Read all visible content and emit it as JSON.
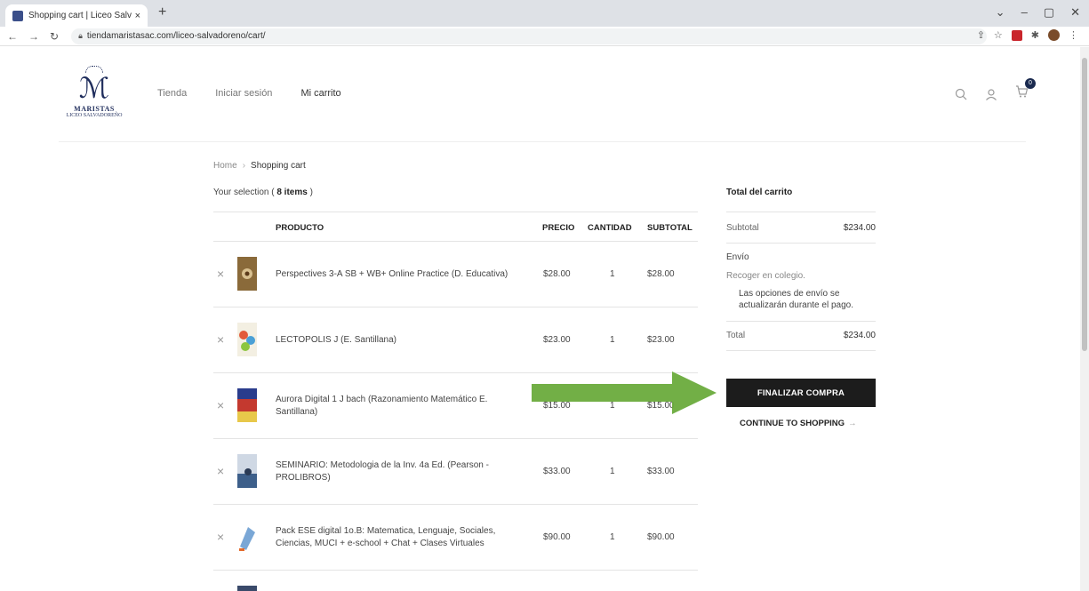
{
  "browser": {
    "tab_title": "Shopping cart | Liceo Salvadoreñ",
    "tab_close": "×",
    "new_tab": "+",
    "url": "tiendamaristasac.com/liceo-salvadoreno/cart/",
    "window_controls": [
      "⌄",
      "–",
      "▢",
      "✕"
    ]
  },
  "site": {
    "logo_line1": "MARISTAS",
    "logo_line2": "LICEO SALVADOREÑO",
    "nav": [
      {
        "label": "Tienda"
      },
      {
        "label": "Iniciar sesión"
      },
      {
        "label": "Mi carrito"
      }
    ],
    "cart_count": "0"
  },
  "breadcrumb": {
    "home": "Home",
    "separator": "›",
    "current": "Shopping cart"
  },
  "selection": {
    "prefix": "Your selection (",
    "count": "8 items",
    "suffix": ")"
  },
  "table": {
    "headers": {
      "product": "PRODUCTO",
      "price": "PRECIO",
      "qty": "CANTIDAD",
      "subtotal": "SUBTOTAL"
    },
    "rows": [
      {
        "name": "Perspectives 3-A SB + WB+ Online Practice (D. Educativa)",
        "price": "$28.00",
        "qty": "1",
        "subtotal": "$28.00"
      },
      {
        "name": "LECTOPOLIS J (E. Santillana)",
        "price": "$23.00",
        "qty": "1",
        "subtotal": "$23.00"
      },
      {
        "name": "Aurora Digital 1 J bach (Razonamiento Matemático E. Santillana)",
        "price": "$15.00",
        "qty": "1",
        "subtotal": "$15.00"
      },
      {
        "name": "SEMINARIO: Metodologia de la Inv. 4a Ed. (Pearson - PROLIBROS)",
        "price": "$33.00",
        "qty": "1",
        "subtotal": "$33.00"
      },
      {
        "name": "Pack ESE digital 1o.B: Matematica, Lenguaje, Sociales, Ciencias, MUCI + e-school + Chat + Clases Virtuales",
        "price": "$90.00",
        "qty": "1",
        "subtotal": "$90.00"
      }
    ]
  },
  "totals": {
    "title": "Total del carrito",
    "subtotal_label": "Subtotal",
    "subtotal_value": "$234.00",
    "shipping_label": "Envío",
    "shipping_option": "Recoger en colegio.",
    "shipping_note": "Las opciones de envío se actualizarán durante el pago.",
    "total_label": "Total",
    "total_value": "$234.00",
    "checkout_label": "FINALIZAR COMPRA",
    "continue_label": "CONTINUE TO SHOPPING",
    "continue_arrow": "→"
  },
  "colors": {
    "accent_dark": "#1c1c1c",
    "overlay_arrow": "#6aab3c",
    "brand_navy": "#1f2d5c"
  }
}
